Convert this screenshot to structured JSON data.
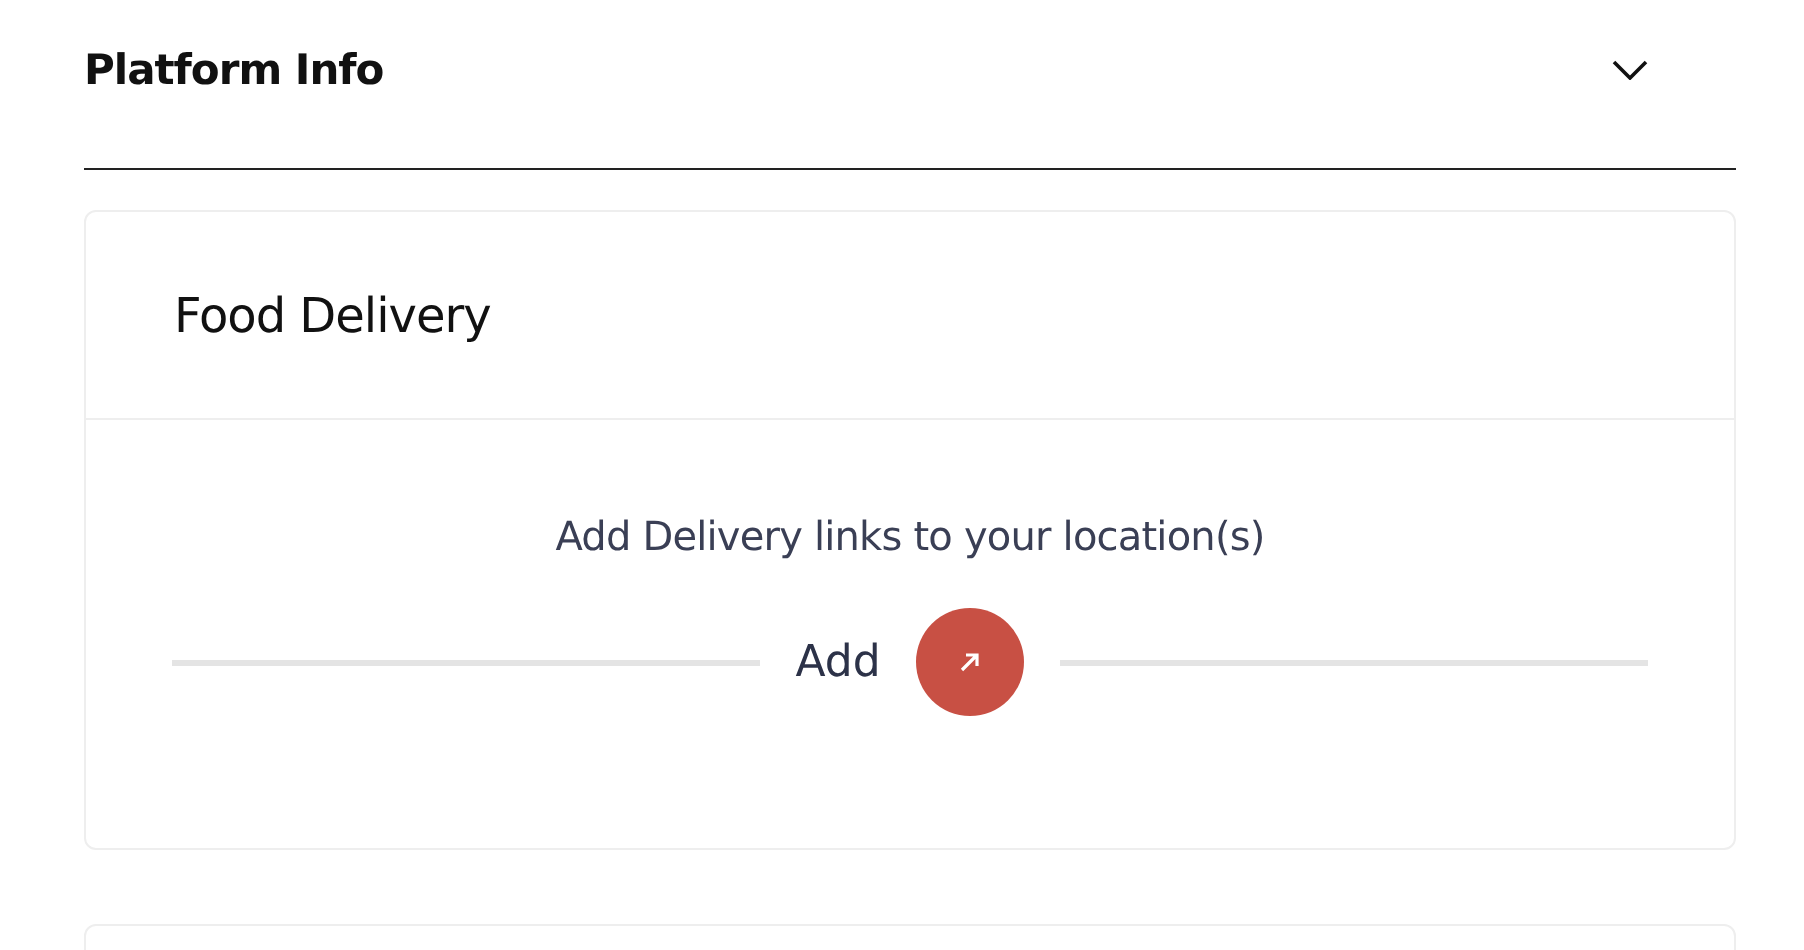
{
  "section": {
    "title": "Platform Info",
    "expanded": true
  },
  "card": {
    "title": "Food Delivery",
    "message": "Add Delivery links to your location(s)",
    "add_label": "Add"
  }
}
